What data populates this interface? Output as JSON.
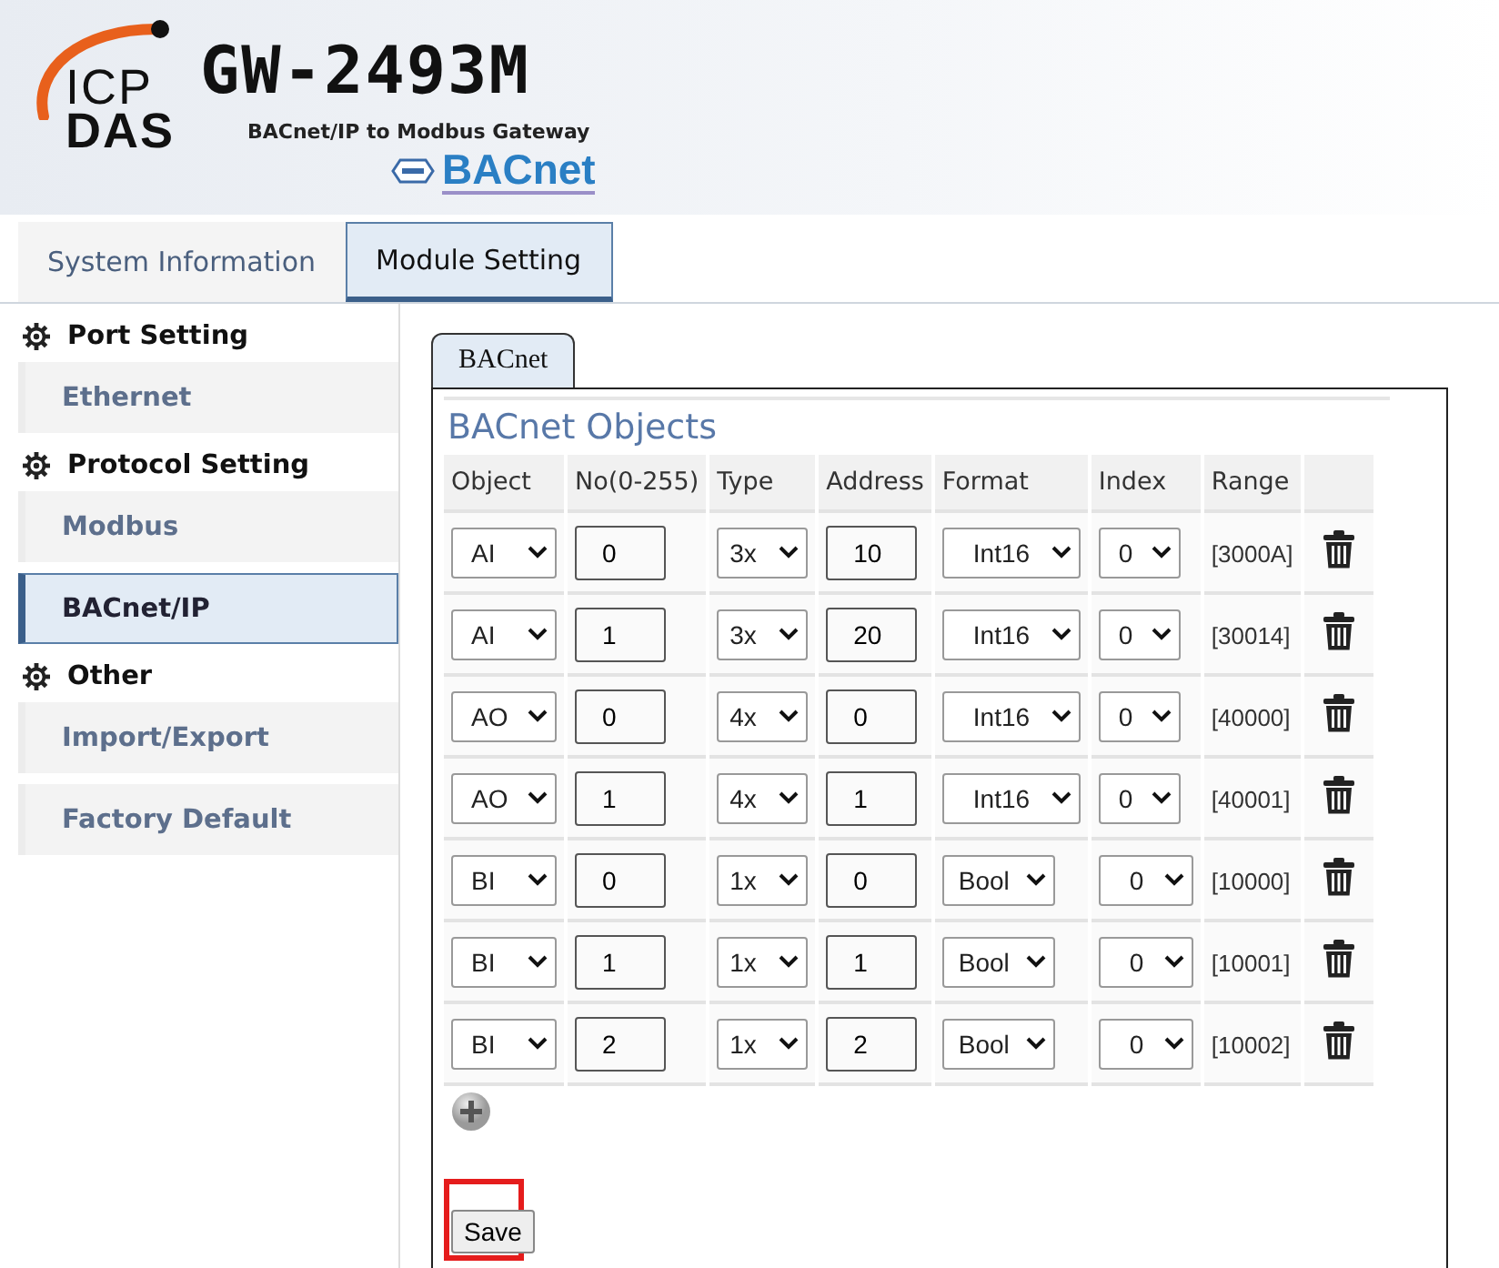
{
  "header": {
    "logo_top": "ICP",
    "logo_bottom": "DAS",
    "model": "GW-2493M",
    "subtitle": "BACnet/IP to Modbus Gateway",
    "badge": "BACnet"
  },
  "tabs": [
    {
      "label": "System Information",
      "selected": false
    },
    {
      "label": "Module Setting",
      "selected": true
    }
  ],
  "sidebar": {
    "sections": [
      {
        "title": "Port Setting",
        "items": [
          {
            "label": "Ethernet",
            "selected": false
          }
        ]
      },
      {
        "title": "Protocol Setting",
        "items": [
          {
            "label": "Modbus",
            "selected": false
          },
          {
            "label": "BACnet/IP",
            "selected": true
          }
        ]
      },
      {
        "title": "Other",
        "items": [
          {
            "label": "Import/Export",
            "selected": false
          },
          {
            "label": "Factory Default",
            "selected": false
          }
        ]
      }
    ]
  },
  "content_tabs": [
    {
      "label": "BACnet",
      "selected": true
    }
  ],
  "panel": {
    "title": "BACnet Objects",
    "columns": [
      "Object",
      "No(0-255)",
      "Type",
      "Address",
      "Format",
      "Index",
      "Range"
    ],
    "rows": [
      {
        "object": "AI",
        "no": "0",
        "type": "3x",
        "address": "10",
        "format": "Int16",
        "index": "0",
        "range": "[3000A]"
      },
      {
        "object": "AI",
        "no": "1",
        "type": "3x",
        "address": "20",
        "format": "Int16",
        "index": "0",
        "range": "[30014]"
      },
      {
        "object": "AO",
        "no": "0",
        "type": "4x",
        "address": "0",
        "format": "Int16",
        "index": "0",
        "range": "[40000]"
      },
      {
        "object": "AO",
        "no": "1",
        "type": "4x",
        "address": "1",
        "format": "Int16",
        "index": "0",
        "range": "[40001]"
      },
      {
        "object": "BI",
        "no": "0",
        "type": "1x",
        "address": "0",
        "format": "Bool",
        "index": "0",
        "range": "[10000]"
      },
      {
        "object": "BI",
        "no": "1",
        "type": "1x",
        "address": "1",
        "format": "Bool",
        "index": "0",
        "range": "[10001]"
      },
      {
        "object": "BI",
        "no": "2",
        "type": "1x",
        "address": "2",
        "format": "Bool",
        "index": "0",
        "range": "[10002]"
      }
    ],
    "save": {
      "label": "Save",
      "highlighted": true
    }
  }
}
